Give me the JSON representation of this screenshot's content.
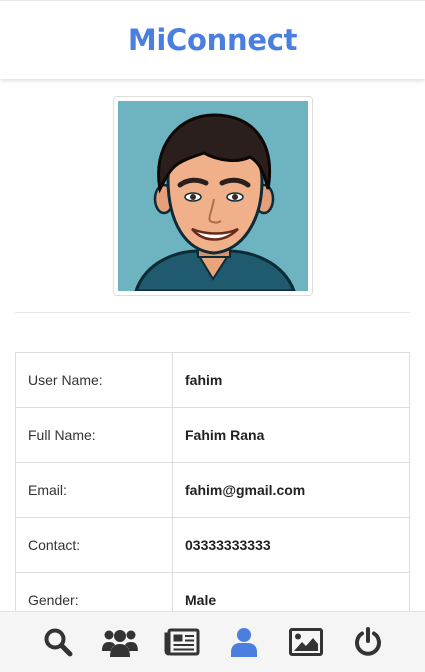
{
  "header": {
    "title": "MiConnect"
  },
  "profile": {
    "rows": [
      {
        "label": "User Name:",
        "value": "fahim"
      },
      {
        "label": "Full Name:",
        "value": "Fahim Rana"
      },
      {
        "label": "Email:",
        "value": "fahim@gmail.com"
      },
      {
        "label": "Contact:",
        "value": "03333333333"
      },
      {
        "label": "Gender:",
        "value": "Male"
      }
    ]
  },
  "bottom_nav": {
    "items": [
      {
        "icon": "search-icon",
        "active": false
      },
      {
        "icon": "users-icon",
        "active": false
      },
      {
        "icon": "newspaper-icon",
        "active": false
      },
      {
        "icon": "user-icon",
        "active": true
      },
      {
        "icon": "image-icon",
        "active": false
      },
      {
        "icon": "power-icon",
        "active": false
      }
    ]
  },
  "colors": {
    "brand": "#4a7fe0",
    "icon": "#333333",
    "icon_active": "#4a7fe0",
    "avatar_background": "#6eb4c0"
  }
}
